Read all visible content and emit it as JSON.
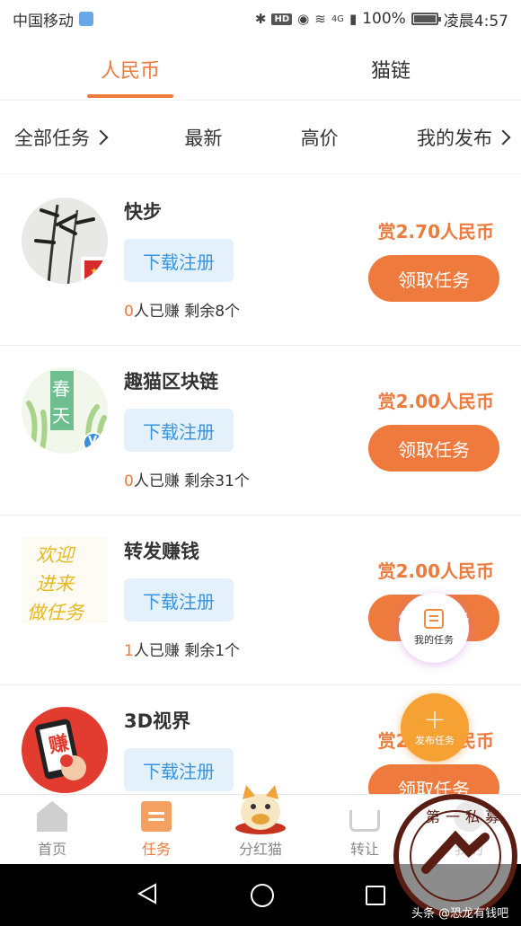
{
  "status_bar": {
    "carrier": "中国移动",
    "hd_badge": "HD",
    "network": "4G",
    "battery_text": "100%",
    "battery_level": 1.0,
    "time": "凌晨4:57"
  },
  "top_tabs": [
    {
      "label": "人民币",
      "active": true
    },
    {
      "label": "猫链",
      "active": false
    }
  ],
  "filters": {
    "all_tasks": "全部任务",
    "latest": "最新",
    "high_price": "高价",
    "my_posts": "我的发布"
  },
  "tasks": [
    {
      "title": "快步",
      "download_label": "下载注册",
      "earned_count": "0",
      "stats_suffix": "人已赚 剩余8个",
      "reward": "赏2.70人民币",
      "claim_label": "领取任务"
    },
    {
      "title": "趣猫区块链",
      "download_label": "下载注册",
      "earned_count": "0",
      "stats_suffix": "人已赚 剩余31个",
      "reward": "赏2.00人民币",
      "claim_label": "领取任务"
    },
    {
      "title": "转发赚钱",
      "download_label": "下载注册",
      "earned_count": "1",
      "stats_suffix": "人已赚 剩余1个",
      "reward": "赏2.00人民币",
      "claim_label": "领取任务"
    },
    {
      "title": "3D视界",
      "download_label": "下载注册",
      "earned_count": "",
      "stats_suffix": "",
      "reward": "赏2.00人民币",
      "claim_label": "领取任务"
    }
  ],
  "thumb_text": {
    "task2": [
      "春",
      "天"
    ],
    "task2_badge": "V",
    "task3": [
      "欢迎",
      "进来",
      "做任务"
    ],
    "task4": "赚"
  },
  "fab": {
    "my_tasks": "我的任务",
    "post_task": "发布任务"
  },
  "bottom_nav": [
    {
      "label": "首页",
      "icon": "home-icon",
      "active": false
    },
    {
      "label": "任务",
      "icon": "task-list-icon",
      "active": true
    },
    {
      "label": "分红猫",
      "icon": "lucky-cat-icon",
      "active": false
    },
    {
      "label": "转让",
      "icon": "cart-icon",
      "active": false
    },
    {
      "label": "我的",
      "icon": "profile-icon",
      "active": false
    }
  ],
  "watermark": {
    "text": "第一私募",
    "credit": "头条 @恐龙有钱吧"
  },
  "colors": {
    "accent": "#ee7a3e",
    "download_bg": "#e4f1fb",
    "download_text": "#3a94dd",
    "fab_post": "#f6a134"
  }
}
